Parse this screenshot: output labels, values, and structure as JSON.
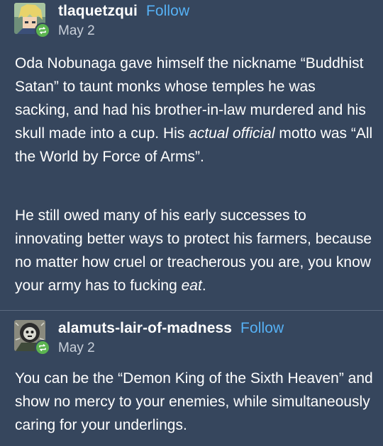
{
  "posts": [
    {
      "username": "tlaquetzqui",
      "follow_label": "Follow",
      "date": "May 2",
      "paragraphs": [
        {
          "before": "Oda Nobunaga gave himself the nickname “Buddhist Satan” to taunt monks whose temples he was sacking, and had his brother-in-law murdered and his skull made into a cup. His ",
          "emphasis": "actual official",
          "after": " motto was “All the World by Force of Arms”."
        },
        {
          "before": "He still owed many of his early successes to innovating better ways to protect his farmers, because no matter how cruel or treacherous you are, you know your army has to fucking ",
          "emphasis": "eat",
          "after": "."
        }
      ]
    },
    {
      "username": "alamuts-lair-of-madness",
      "follow_label": "Follow",
      "date": "May 2",
      "paragraphs": [
        {
          "text": "You can be the  “Demon King of the Sixth Heaven” and show no mercy to your enemies, while simultaneously caring for your underlings."
        }
      ]
    }
  ],
  "colors": {
    "background": "#36465d",
    "follow": "#56b1f5",
    "reblog_badge": "#5bb450",
    "divider": "#5b6a80"
  },
  "icons": {
    "avatar_1": "avatar-blond-anime-character",
    "avatar_2": "avatar-masked-figure",
    "reblog": "reblog-icon"
  }
}
